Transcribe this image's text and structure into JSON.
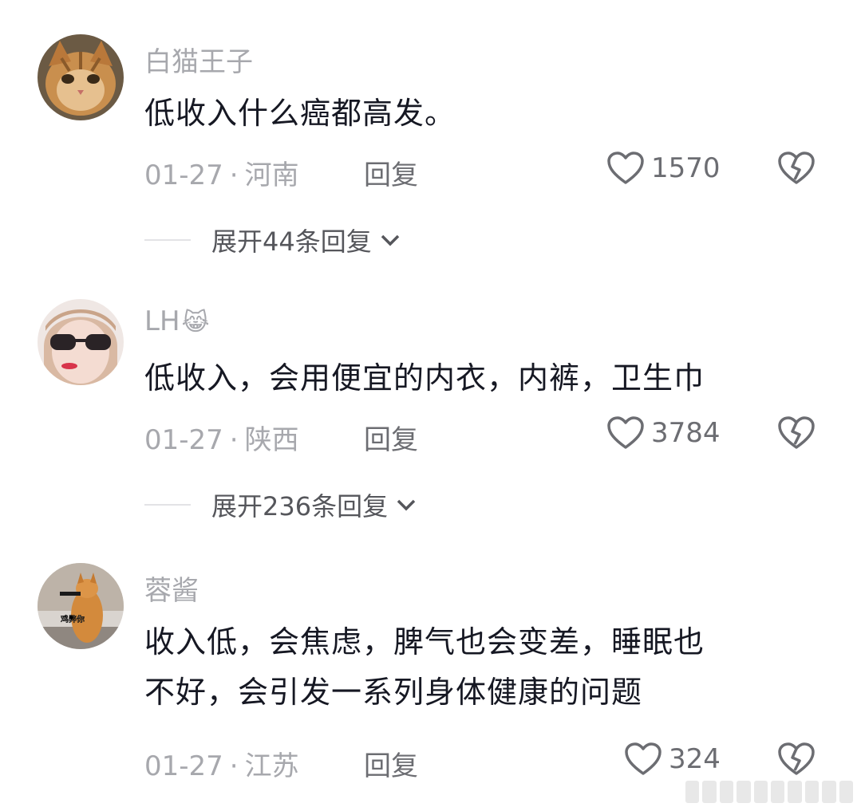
{
  "comments": [
    {
      "username": "白猫王子",
      "username_emoji": "",
      "avatar_icon": "cat-avatar",
      "lines": [
        "低收入什么癌都高发。"
      ],
      "date": "01-27",
      "separator": "·",
      "location": "河南",
      "reply_label": "回复",
      "likes": "1570",
      "expand_label": "展开44条回复"
    },
    {
      "username": "LH",
      "username_emoji": "😹",
      "avatar_icon": "woman-sunglasses-avatar",
      "lines": [
        "低收入，会用便宜的内衣，内裤，卫生巾"
      ],
      "date": "01-27",
      "separator": "·",
      "location": "陕西",
      "reply_label": "回复",
      "likes": "3784",
      "expand_label": "展开236条回复"
    },
    {
      "username": "蓉酱",
      "username_emoji": "",
      "avatar_icon": "cat-meme-avatar",
      "avatar_caption": "鸡弊你",
      "lines": [
        "收入低，会焦虑，脾气也会变差，睡眠也",
        "不好，会引发一系列身体健康的问题"
      ],
      "date": "01-27",
      "separator": "·",
      "location": "江苏",
      "reply_label": "回复",
      "likes": "324"
    }
  ],
  "colors": {
    "text_primary": "#161823",
    "text_secondary": "#a7a8ad",
    "text_action": "#6c6d72",
    "background": "#ffffff"
  }
}
